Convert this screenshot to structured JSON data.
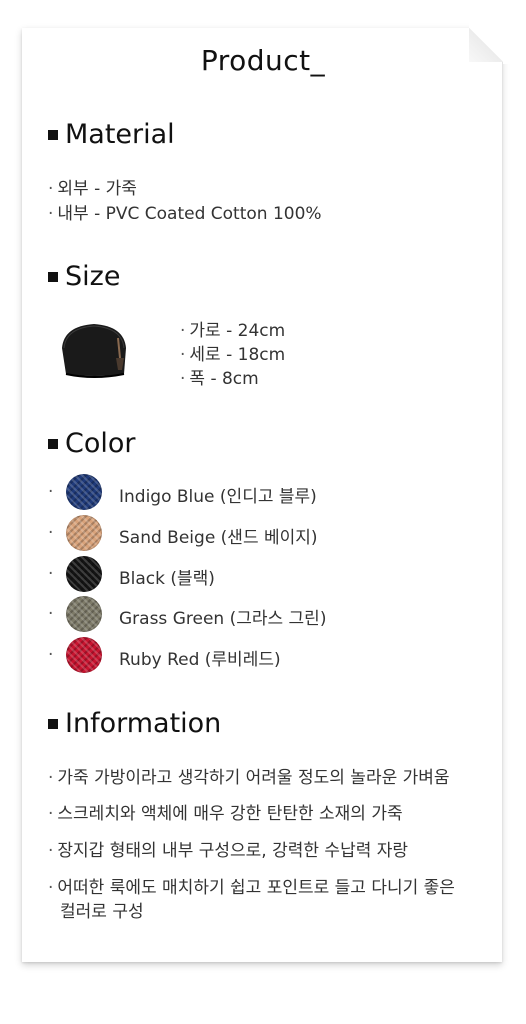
{
  "title": "Product_",
  "material": {
    "heading": "Material",
    "lines": [
      "외부 - 가죽",
      "내부 - PVC Coated Cotton 100%"
    ]
  },
  "size": {
    "heading": "Size",
    "lines": [
      "가로 - 24cm",
      "세로 - 18cm",
      "폭 - 8cm"
    ]
  },
  "color": {
    "heading": "Color",
    "items": [
      {
        "label": "Indigo Blue (인디고 블루)",
        "hex": "#1f3a7a"
      },
      {
        "label": "Sand Beige (샌드 베이지)",
        "hex": "#d8a27a"
      },
      {
        "label": "Black (블랙)",
        "hex": "#141414"
      },
      {
        "label": "Grass Green (그라스 그린)",
        "hex": "#7d7a68"
      },
      {
        "label": "Ruby Red (루비레드)",
        "hex": "#c8132f"
      }
    ]
  },
  "information": {
    "heading": "Information",
    "lines": [
      "가죽 가방이라고 생각하기 어려울 정도의 놀라운 가벼움",
      "스크레치와 액체에 매우 강한 탄탄한 소재의 가죽",
      "장지갑 형태의 내부 구성으로, 강력한 수납력 자랑",
      "어떠한 룩에도 매치하기 쉽고 포인트로 들고 다니기 좋은",
      "컬러로 구성"
    ]
  },
  "bullet": "·"
}
